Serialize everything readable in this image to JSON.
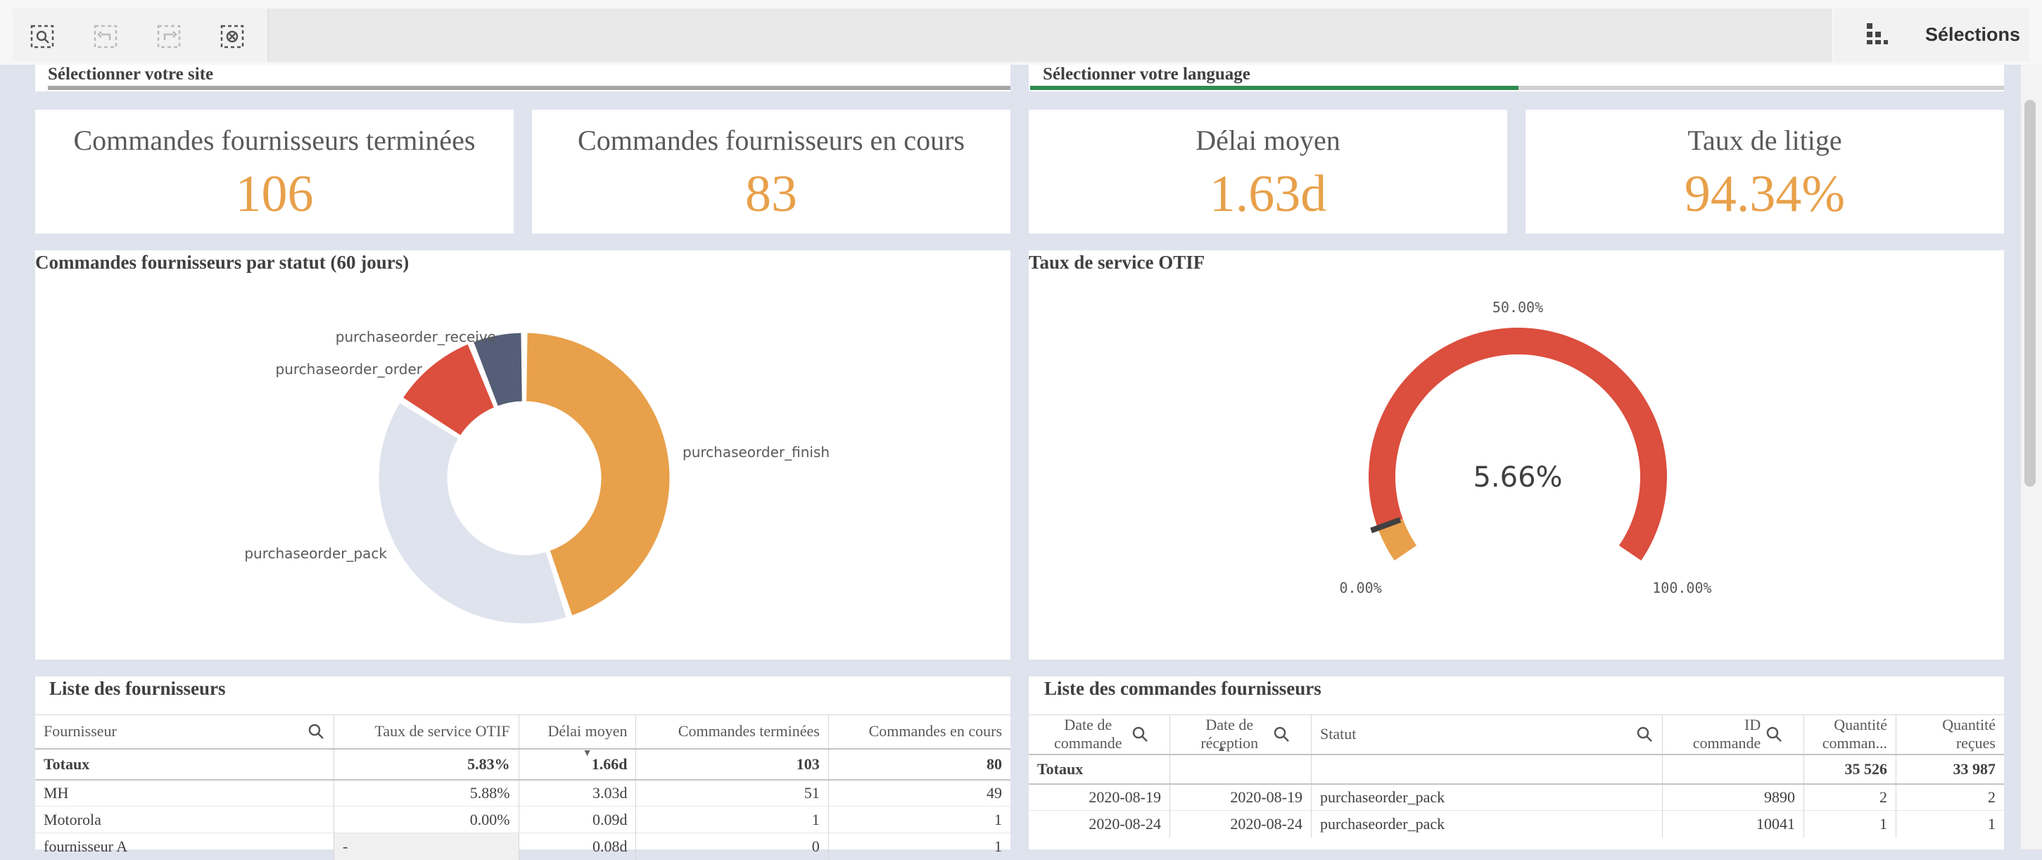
{
  "toolbar": {
    "icons": [
      "selection-search-icon",
      "step-back-icon",
      "step-forward-icon",
      "clear-selections-icon"
    ],
    "selections_label": "Sélections"
  },
  "filters": {
    "site_label": "Sélectionner votre site",
    "language_label": "Sélectionner votre language"
  },
  "kpis": [
    {
      "label": "Commandes fournisseurs terminées",
      "value": "106"
    },
    {
      "label": "Commandes fournisseurs en cours",
      "value": "83"
    },
    {
      "label": "Délai moyen",
      "value": "1.63d"
    },
    {
      "label": "Taux de litige",
      "value": "94.34%"
    }
  ],
  "donut": {
    "title": "Commandes fournisseurs par statut (60 jours)",
    "chart_data": {
      "type": "pie",
      "categories": [
        "purchaseorder_finish",
        "purchaseorder_pack",
        "purchaseorder_order",
        "purchaseorder_receive"
      ],
      "values": [
        45,
        39,
        10,
        6
      ],
      "colors": [
        "#e8a04a",
        "#dfe3ee",
        "#dc4e3e",
        "#545e76"
      ]
    }
  },
  "gauge": {
    "title": "Taux de service OTIF",
    "value_label": "5.66%",
    "min_label": "0.00%",
    "max_label": "100.00%",
    "target_label": "50.00%",
    "chart_data": {
      "type": "gauge",
      "value": 5.66,
      "min": 0,
      "max": 100,
      "target": 50,
      "colors": {
        "low": "#e8a04a",
        "high": "#dc4e3e",
        "pointer": "#404040"
      }
    }
  },
  "suppliers": {
    "title": "Liste des fournisseurs",
    "columns": [
      "Fournisseur",
      "Taux de service OTIF",
      "Délai moyen",
      "Commandes terminées",
      "Commandes en cours"
    ],
    "totals": [
      "Totaux",
      "5.83%",
      "1.66d",
      "103",
      "80"
    ],
    "rows": [
      [
        "MH",
        "5.88%",
        "3.03d",
        "51",
        "49"
      ],
      [
        "Motorola",
        "0.00%",
        "0.09d",
        "1",
        "1"
      ],
      [
        "fournisseur A",
        "-",
        "0.08d",
        "0",
        "1"
      ]
    ]
  },
  "orders": {
    "title": "Liste des commandes fournisseurs",
    "columns": [
      "Date de commande",
      "Date de réception",
      "Statut",
      "ID commande",
      "Quantité comman...",
      "Quantité reçues"
    ],
    "totals": [
      "Totaux",
      "",
      "",
      "",
      "35 526",
      "33 987"
    ],
    "rows": [
      [
        "2020-08-19",
        "2020-08-19",
        "purchaseorder_pack",
        "9890",
        "2",
        "2"
      ],
      [
        "2020-08-24",
        "2020-08-24",
        "purchaseorder_pack",
        "10041",
        "1",
        "1"
      ]
    ]
  }
}
